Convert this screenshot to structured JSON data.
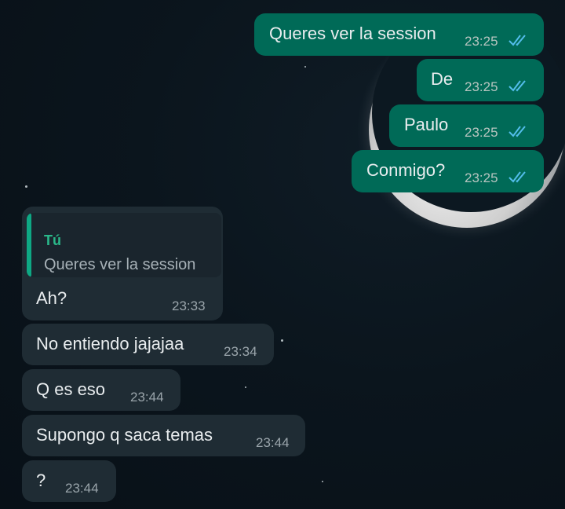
{
  "colors": {
    "outgoing_bubble": "#006a57",
    "incoming_bubble": "#1f2c34",
    "read_ticks": "#53bdeb",
    "quote_author": "#2ab889"
  },
  "messages": [
    {
      "direction": "outgoing",
      "text": "Queres ver la session",
      "time": "23:25",
      "status": "read"
    },
    {
      "direction": "outgoing",
      "text": "De",
      "time": "23:25",
      "status": "read"
    },
    {
      "direction": "outgoing",
      "text": "Paulo",
      "time": "23:25",
      "status": "read"
    },
    {
      "direction": "outgoing",
      "text": "Conmigo?",
      "time": "23:25",
      "status": "read"
    },
    {
      "direction": "incoming",
      "text": "Ah?",
      "time": "23:33",
      "reply_to": {
        "author": "Tú",
        "text": "Queres ver la session"
      }
    },
    {
      "direction": "incoming",
      "text": "No entiendo jajajaa",
      "time": "23:34"
    },
    {
      "direction": "incoming",
      "text": "Q es eso",
      "time": "23:44"
    },
    {
      "direction": "incoming",
      "text": "Supongo q saca temas",
      "time": "23:44"
    },
    {
      "direction": "incoming",
      "text": "?",
      "time": "23:44"
    }
  ]
}
